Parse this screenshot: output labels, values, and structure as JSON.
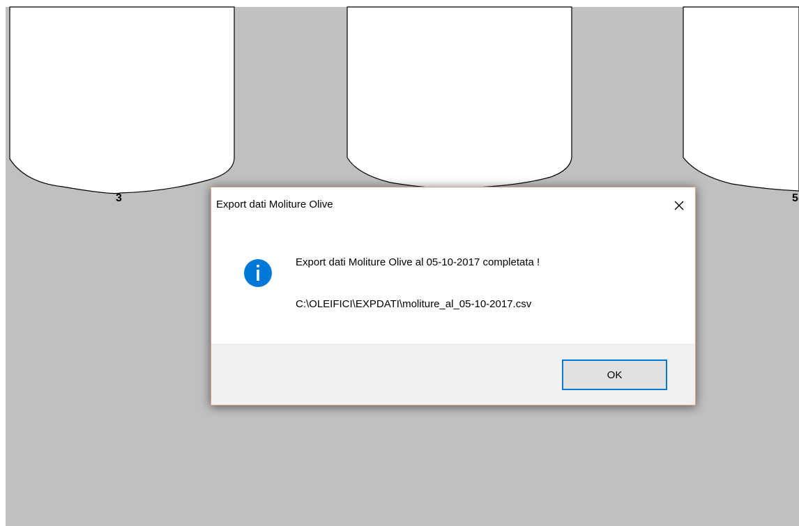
{
  "background": {
    "tanks": [
      {
        "label": "3"
      },
      {
        "label": ""
      },
      {
        "label": "5"
      }
    ]
  },
  "dialog": {
    "title": "Export dati Moliture Olive",
    "icon": "info-icon",
    "message": "Export dati Moliture Olive al 05-10-2017 completata !",
    "path": "C:\\OLEIFICI\\EXPDATI\\moliture_al_05-10-2017.csv",
    "ok_label": "OK"
  },
  "colors": {
    "background_gray": "#c0c0c0",
    "dialog_border": "#e2a07f",
    "info_icon_blue": "#0078d7",
    "button_focus": "#0078d7",
    "button_bar": "#f0f0f0"
  }
}
